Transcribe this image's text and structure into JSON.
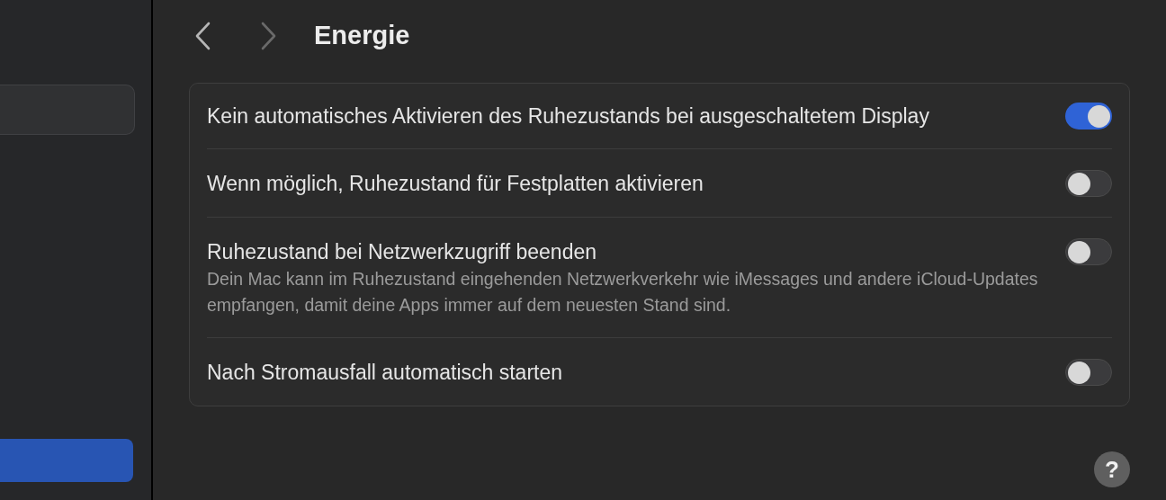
{
  "header": {
    "title": "Energie"
  },
  "settings": [
    {
      "label": "Kein automatisches Aktivieren des Ruhezustands bei ausgeschaltetem Display",
      "on": true
    },
    {
      "label": "Wenn möglich, Ruhezustand für Festplatten aktivieren",
      "on": false
    },
    {
      "label": "Ruhezustand bei Netzwerkzugriff beenden",
      "description": "Dein Mac kann im Ruhezustand eingehenden Netzwerkverkehr wie iMessages und andere iCloud-Updates empfangen, damit deine Apps immer auf dem neuesten Stand sind.",
      "on": false
    },
    {
      "label": "Nach Stromausfall automatisch starten",
      "on": false
    }
  ],
  "help_button": {
    "label": "?"
  }
}
